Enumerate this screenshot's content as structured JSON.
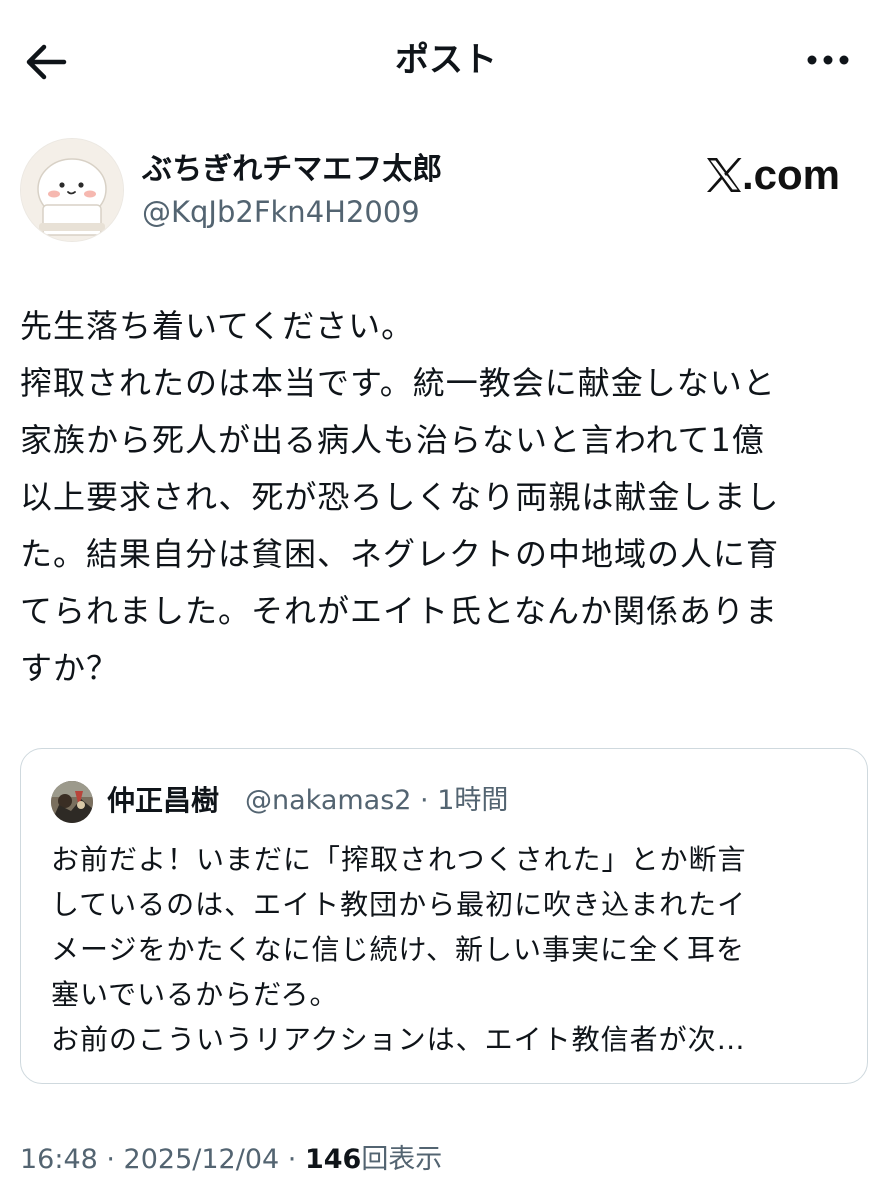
{
  "header": {
    "title": "ポスト",
    "back_icon": "arrow-left-icon",
    "more_icon": "more-horizontal-icon"
  },
  "author": {
    "display_name": "ぶちぎれチマエフ太郎",
    "handle": "@KqJb2Fkn4H2009",
    "avatar_icon": "cartoon-ghost-avatar"
  },
  "brand": {
    "text": ".com",
    "logo_icon": "x-logo-icon"
  },
  "post": {
    "text": "先生落ち着いてください。\n搾取されたのは本当です。統一教会に献金しないと\n家族から死人が出る病人も治らないと言われて1億\n以上要求され、死が恐ろしくなり両親は献金しまし\nた。結果自分は貧困、ネグレクトの中地域の人に育\nてられました。それがエイト氏となんか関係ありま\nすか？"
  },
  "quote": {
    "name": "仲正昌樹",
    "handle_time": "@nakamas2 · 1時間",
    "text": "お前だよ！いまだに「搾取されつくされた」とか断言\nしているのは、エイト教団から最初に吹き込まれたイ\nメージをかたくなに信じ続け、新しい事実に全く耳を\n塞いでいるからだろ。\nお前のこういうリアクションは、エイト教信者が次…"
  },
  "footer": {
    "time_date": "16:48 · 2025/12/04 · ",
    "views_count": "146",
    "views_label": "回表示"
  },
  "colors": {
    "text": "#0f1419",
    "secondary": "#536471",
    "border": "#cfd9de"
  }
}
